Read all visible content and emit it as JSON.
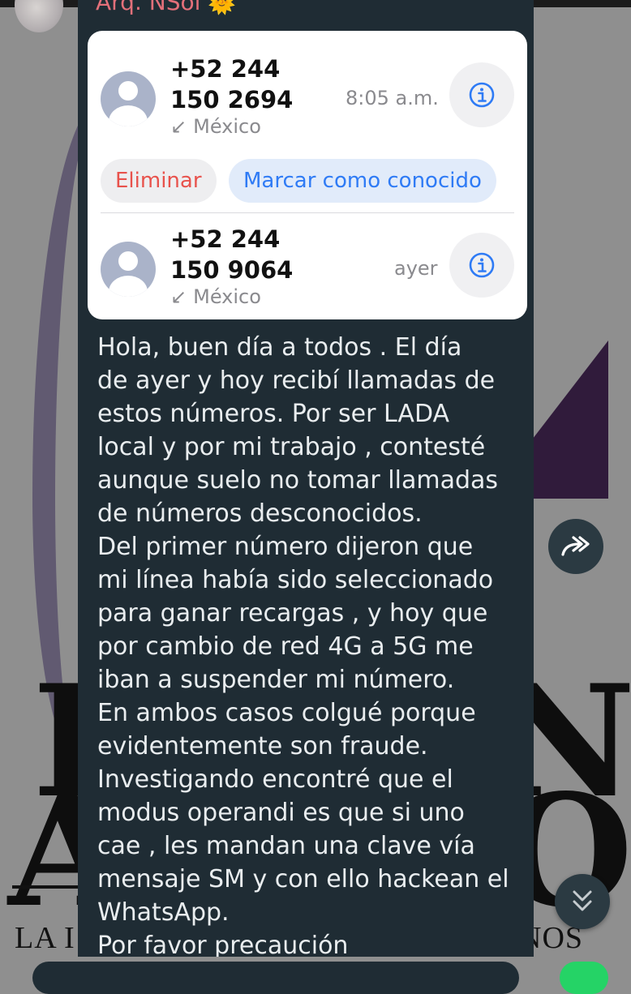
{
  "chat": {
    "sender_name": "Arq. NSol",
    "sender_emoji": "🌞"
  },
  "calls": [
    {
      "number_line1": "+52 244",
      "number_line2": "150 2694",
      "location": "México",
      "time": "8:05 a.m."
    },
    {
      "number_line1": "+52 244",
      "number_line2": "150 9064",
      "location": "México",
      "time": "ayer"
    }
  ],
  "actions": {
    "delete_label": "Eliminar",
    "mark_known_label": "Marcar como conocido"
  },
  "message": {
    "text": "Hola, buen día a todos . El día\nde ayer y hoy recibí llamadas de\nestos números. Por ser LADA\nlocal y por mi trabajo , contesté\naunque suelo no tomar llamadas\nde números desconocidos.\nDel primer número dijeron que\nmi línea había sido seleccionado\npara ganar recargas , y hoy que\npor cambio de red 4G a 5G me\niban a suspender mi número.\nEn ambos casos colgué porque\nevidentemente son fraude.\nInvestigando encontré que el\nmodus operandi es que si uno\ncae , les mandan una clave vía\nmensaje SM y con ello hackean el\nWhatsApp.\nPor favor precaución"
  },
  "background": {
    "letter_1": "R",
    "letter_2": "N",
    "letter_3": "A",
    "letter_4": "O",
    "text_left": "LA I",
    "text_right": "NOS"
  },
  "icons": {
    "info": "info-icon",
    "forward": "forward-icon",
    "scroll_down": "chevron-double-down-icon",
    "incoming_call": "incoming-call-arrow-icon"
  },
  "colors": {
    "bubble_bg": "#1f2c34",
    "sender_name": "#e3707a",
    "delete_red": "#e8524c",
    "accent_blue": "#2f7bf5"
  }
}
